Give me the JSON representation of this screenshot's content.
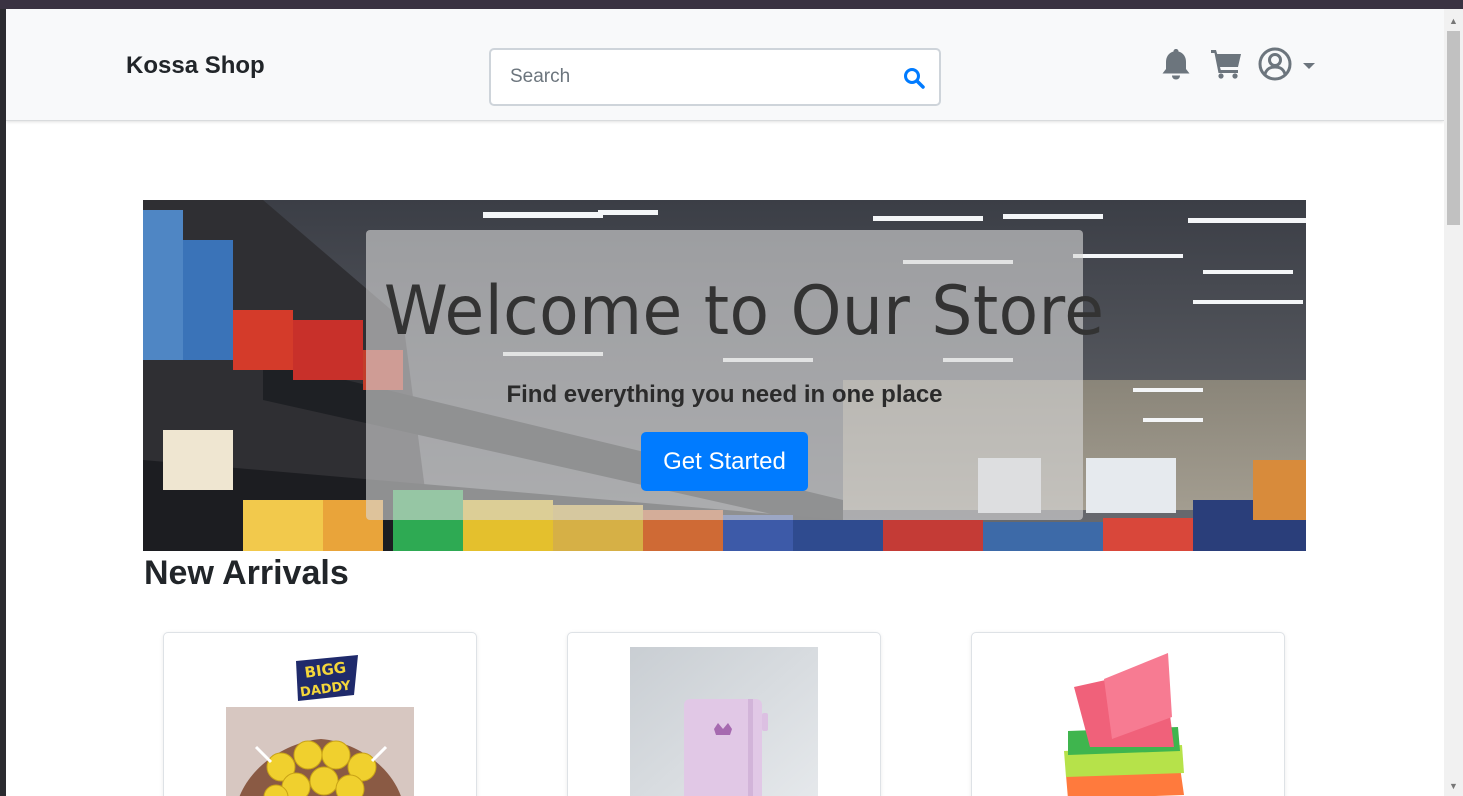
{
  "navbar": {
    "brand": "Kossa Shop",
    "search": {
      "placeholder": "Search",
      "value": ""
    },
    "icons": [
      "bell-icon",
      "cart-icon",
      "user-circle-icon",
      "caret-down-icon"
    ]
  },
  "hero": {
    "title": "Welcome to Our Store",
    "subtitle": "Find everything you need in one place",
    "cta_label": "Get Started"
  },
  "new_arrivals": {
    "title": "New Arrivals",
    "products": [
      {
        "image_icon": "lollipop-product-image",
        "logo_text": "BIGG DADDY"
      },
      {
        "image_icon": "notebook-product-image"
      },
      {
        "image_icon": "sticky-notes-product-image"
      }
    ]
  },
  "colors": {
    "primary": "#007bff",
    "navbar_bg": "#f8f9fa",
    "text": "#212529"
  }
}
